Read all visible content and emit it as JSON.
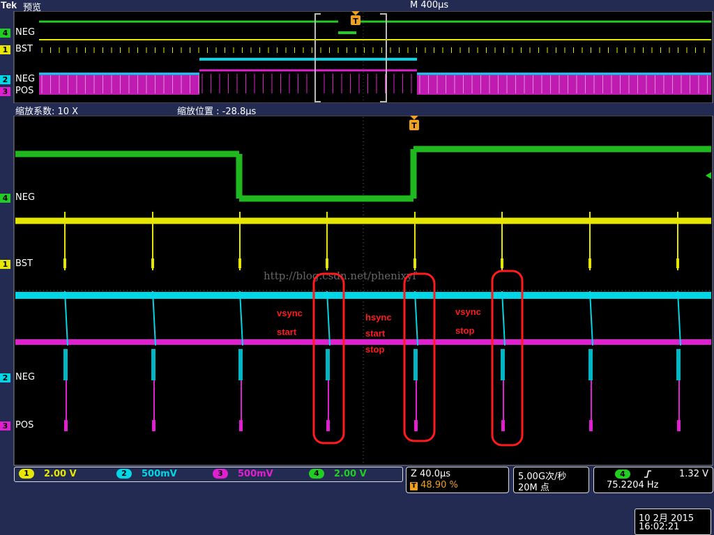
{
  "header": {
    "brand": "Tek",
    "mode": "预览",
    "timebase": "M 400µs"
  },
  "zoom": {
    "factor": "缩放系数: 10 X",
    "position": "缩放位置 :  -28.8µs"
  },
  "overview_labels": [
    {
      "num": "4",
      "label": "NEG",
      "color": "#22cc22"
    },
    {
      "num": "1",
      "label": "BST",
      "color": "#e6e600"
    },
    {
      "num": "2",
      "label": "NEG",
      "color": "#00d6e6"
    },
    {
      "num": "3",
      "label": "POS",
      "color": "#e020d0"
    }
  ],
  "main_labels": [
    {
      "num": "4",
      "label": "NEG",
      "color": "#22cc22"
    },
    {
      "num": "1",
      "label": "BST",
      "color": "#e6e600"
    },
    {
      "num": "2",
      "label": "NEG",
      "color": "#00d6e6"
    },
    {
      "num": "3",
      "label": "POS",
      "color": "#e020d0"
    }
  ],
  "watermark": "http://blog.csdn.net/phenixyf",
  "annotations": {
    "vsync_start": [
      "vsync",
      "start"
    ],
    "hsync": [
      "hsync",
      "start",
      "stop"
    ],
    "vsync_stop": [
      "vsync",
      "stop"
    ]
  },
  "channels": [
    {
      "num": "1",
      "scale": "2.00 V",
      "color": "#e6e600"
    },
    {
      "num": "2",
      "scale": "500mV",
      "color": "#00d6e6"
    },
    {
      "num": "3",
      "scale": "500mV",
      "color": "#e020d0"
    },
    {
      "num": "4",
      "scale": "2.00 V",
      "color": "#22cc22"
    }
  ],
  "horizontal": {
    "zoom_scale": "Z 40.0µs",
    "trigger_pos": "48.90 %"
  },
  "acquisition": {
    "sample_rate": "5.00G次/秒",
    "record_length": "20M 点"
  },
  "trigger": {
    "source": "4",
    "slope_icon": "rising-edge-icon",
    "level": "1.32 V",
    "frequency": "75.2204 Hz"
  },
  "datetime": {
    "date": "10 2月  2015",
    "time": "16:02:21"
  },
  "trigger_marker": "T"
}
